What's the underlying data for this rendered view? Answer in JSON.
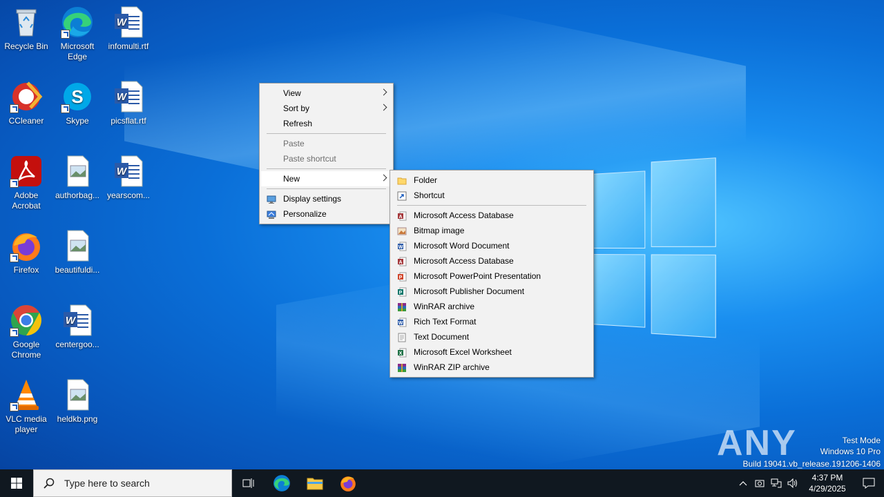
{
  "desktop_icons": [
    {
      "label": "Recycle Bin"
    },
    {
      "label": "Microsoft Edge"
    },
    {
      "label": "infomulti.rtf"
    },
    {
      "label": "CCleaner"
    },
    {
      "label": "Skype"
    },
    {
      "label": "picsflat.rtf"
    },
    {
      "label": "Adobe Acrobat"
    },
    {
      "label": "authorbag..."
    },
    {
      "label": "yearscom..."
    },
    {
      "label": "Firefox"
    },
    {
      "label": "beautifuldi..."
    },
    {
      "label": "Google Chrome"
    },
    {
      "label": "centergoo..."
    },
    {
      "label": "VLC media player"
    },
    {
      "label": "heldkb.png"
    }
  ],
  "context_menu": {
    "view": "View",
    "sort_by": "Sort by",
    "refresh": "Refresh",
    "paste": "Paste",
    "paste_shortcut": "Paste shortcut",
    "new": "New",
    "display_settings": "Display settings",
    "personalize": "Personalize"
  },
  "new_submenu": {
    "folder": "Folder",
    "shortcut": "Shortcut",
    "items": [
      {
        "label": "Microsoft Access Database",
        "icon": "access-icon"
      },
      {
        "label": "Bitmap image",
        "icon": "bitmap-icon"
      },
      {
        "label": "Microsoft Word Document",
        "icon": "word-icon"
      },
      {
        "label": "Microsoft Access Database",
        "icon": "access-icon"
      },
      {
        "label": "Microsoft PowerPoint Presentation",
        "icon": "powerpoint-icon"
      },
      {
        "label": "Microsoft Publisher Document",
        "icon": "publisher-icon"
      },
      {
        "label": "WinRAR archive",
        "icon": "winrar-icon"
      },
      {
        "label": "Rich Text Format",
        "icon": "rtf-icon"
      },
      {
        "label": "Text Document",
        "icon": "text-icon"
      },
      {
        "label": "Microsoft Excel Worksheet",
        "icon": "excel-icon"
      },
      {
        "label": "WinRAR ZIP archive",
        "icon": "winrar-icon"
      }
    ]
  },
  "taskbar": {
    "search_placeholder": "Type here to search",
    "time": "4:37 PM",
    "date": "4/29/2025"
  },
  "watermark": {
    "line1": "Test Mode",
    "line2": "Windows 10 Pro",
    "line3": "Build 19041.vb_release.191206-1406"
  },
  "brand": {
    "anyrun": "ANY RUN"
  }
}
